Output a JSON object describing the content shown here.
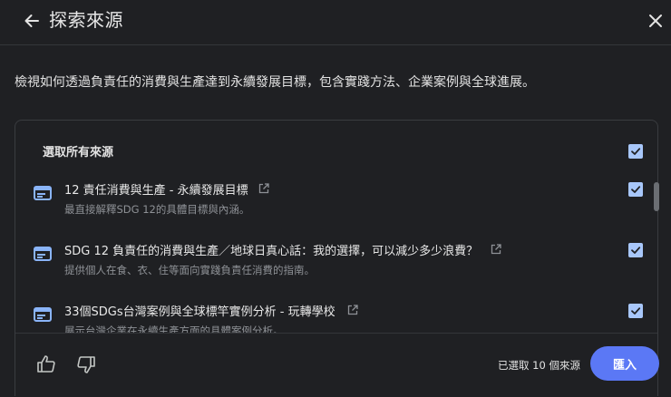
{
  "header": {
    "title": "探索來源",
    "back_icon": "arrow-back-icon",
    "close_icon": "close-icon"
  },
  "description": "檢視如何透過負責任的消費與生產達到永續發展目標，包含實踐方法、企業案例與全球進展。",
  "select_all": {
    "label": "選取所有來源",
    "checked": true
  },
  "sources": [
    {
      "title": "12 責任消費與生產 - 永續發展目標",
      "subtitle": "最直接解釋SDG 12的具體目標與內涵。",
      "checked": true
    },
    {
      "title": "SDG 12 負責任的消費與生產／地球日真心話：我的選擇，可以減少多少浪費？",
      "subtitle": "提供個人在食、衣、住等面向實踐負責任消費的指南。",
      "checked": true
    },
    {
      "title": "33個SDGs台灣案例與全球標竿實例分析 - 玩轉學校",
      "subtitle": "展示台灣企業在永續生產方面的具體案例分析。",
      "checked": true
    }
  ],
  "footer": {
    "count_text": "已選取 10 個來源",
    "import_label": "匯入"
  },
  "colors": {
    "background": "#1f2023",
    "accent": "#5b78f5",
    "checkbox": "#a8c7fa",
    "doc_icon": "#8ab4f8"
  }
}
